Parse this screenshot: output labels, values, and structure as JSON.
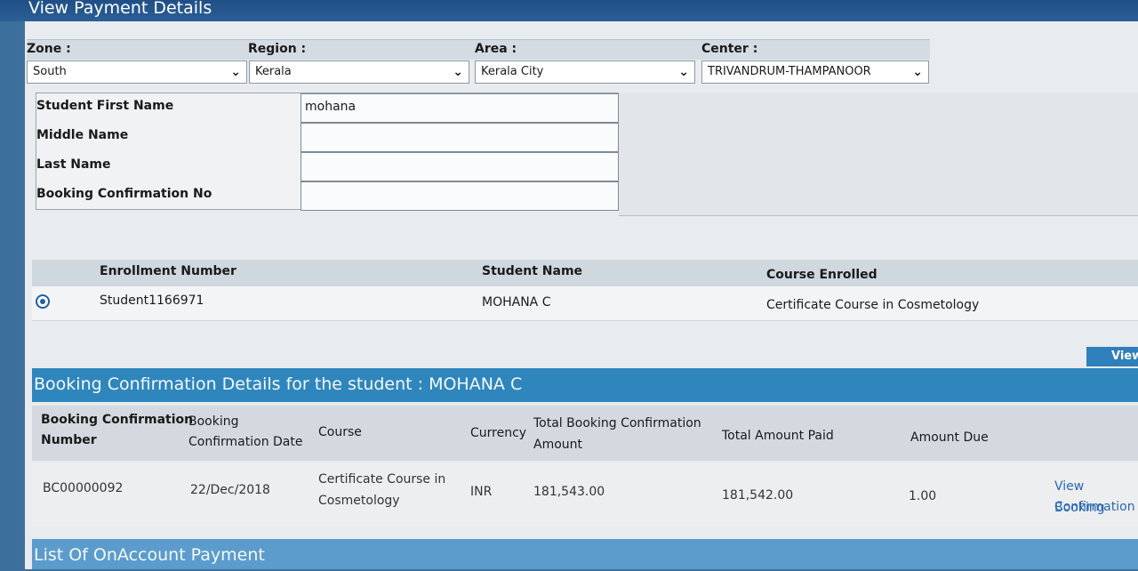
{
  "page_title": "View Payment Details",
  "filters": {
    "zone": {
      "label": "Zone :",
      "value": "South"
    },
    "region": {
      "label": "Region :",
      "value": "Kerala"
    },
    "area": {
      "label": "Area :",
      "value": "Kerala City"
    },
    "center": {
      "label": "Center :",
      "value": "TRIVANDRUM-THAMPANOOR"
    }
  },
  "search": {
    "first_name": {
      "label": "Student First Name",
      "value": "mohana"
    },
    "middle_name": {
      "label": "Middle Name",
      "value": ""
    },
    "last_name": {
      "label": "Last Name",
      "value": ""
    },
    "booking_no": {
      "label": "Booking Confirmation No",
      "value": ""
    }
  },
  "enrollment": {
    "headers": [
      "Enrollment Number",
      "Student Name",
      "Course Enrolled"
    ],
    "rows": [
      {
        "enrollment_number": "Student1166971",
        "student_name": "MOHANA C",
        "course": "Certificate Course in Cosmetology",
        "selected": true
      }
    ]
  },
  "view_button": "View",
  "booking_section": {
    "title": "Booking Confirmation Details for the student : MOHANA C",
    "headers": {
      "number_l1": "Booking Confirmation",
      "number_l2": "Number",
      "date_l1": "Booking",
      "date_l2": "Confirmation Date",
      "course": "Course",
      "currency": "Currency",
      "total_l1": "Total Booking Confirmation",
      "total_l2": "Amount",
      "paid": "Total Amount Paid",
      "due": "Amount Due"
    },
    "rows": [
      {
        "number": "BC00000092",
        "date": "22/Dec/2018",
        "course_l1": "Certificate Course in",
        "course_l2": "Cosmetology",
        "currency": "INR",
        "total": "181,543.00",
        "paid": "181,542.00",
        "due": "1.00",
        "link_l1": "View Booking",
        "link_l2": "Confirmation"
      }
    ]
  },
  "onaccount_section": {
    "title": "List Of OnAccount Payment"
  }
}
